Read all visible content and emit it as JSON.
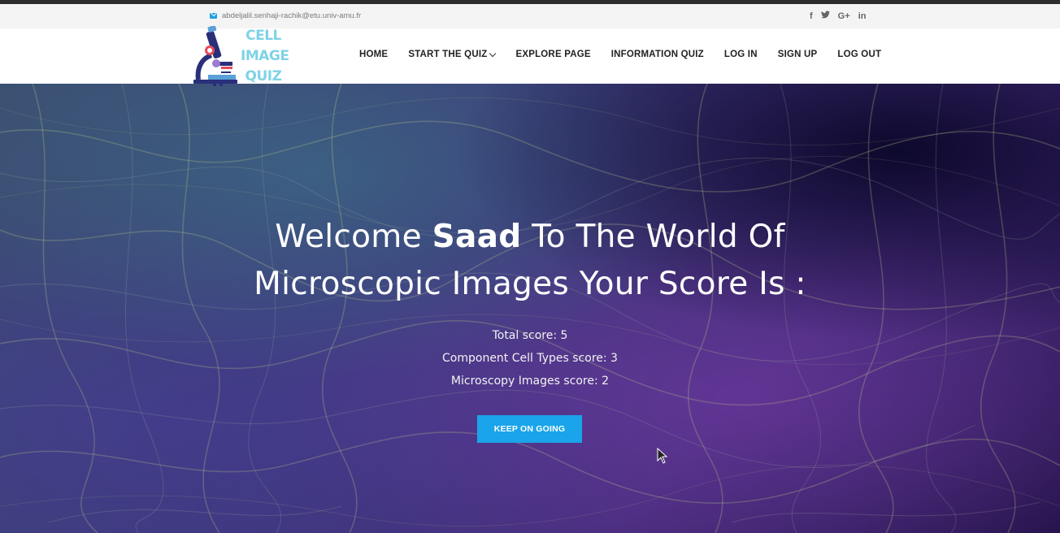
{
  "topbar": {
    "email": "abdeljalil.senhaji-rachik@etu.univ-amu.fr",
    "social": [
      {
        "icon": "facebook-icon",
        "glyph": "f"
      },
      {
        "icon": "twitter-icon",
        "glyph": "❧"
      },
      {
        "icon": "google-plus-icon",
        "glyph": "G+"
      },
      {
        "icon": "linkedin-icon",
        "glyph": "in"
      }
    ]
  },
  "brand": {
    "logo_icon": "microscope-icon",
    "logo_line1": "CELL",
    "logo_line2": "IMAGE",
    "logo_line3": "QUIZ"
  },
  "nav": {
    "items": [
      {
        "label": "HOME"
      },
      {
        "label": "START THE QUIZ",
        "has_dropdown": true
      },
      {
        "label": "EXPLORE PAGE"
      },
      {
        "label": "INFORMATION QUIZ"
      },
      {
        "label": "LOG IN"
      },
      {
        "label": "SIGN UP"
      },
      {
        "label": "LOG OUT"
      }
    ]
  },
  "hero": {
    "title_part1": "Welcome ",
    "username": "Saad",
    "title_part2": " To The World Of",
    "title_line2": "Microscopic Images Your Score Is :",
    "scores": [
      "Total score: 5",
      "Component Cell Types score: 3",
      "Microscopy Images score: 2"
    ],
    "button_label": "KEEP ON GOING"
  },
  "colors": {
    "accent": "#1aa4ea",
    "logo_text": "#7fd3e6",
    "topbar_bg": "#f4f4f4"
  }
}
